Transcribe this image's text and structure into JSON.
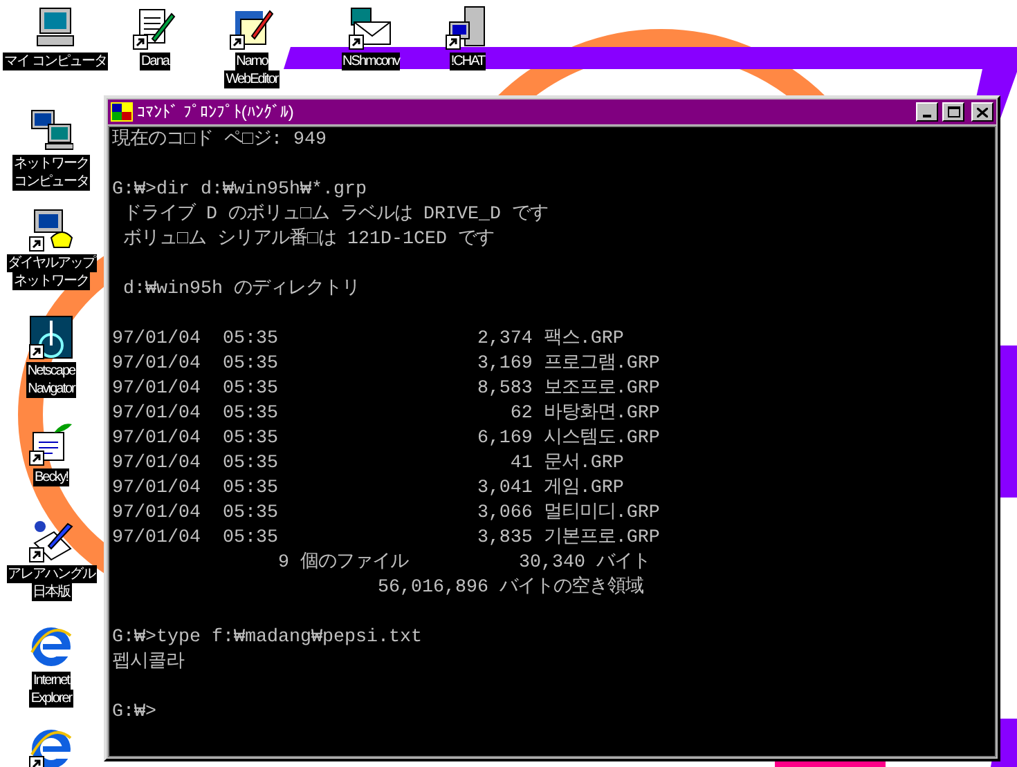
{
  "desktop": {
    "top_row": [
      {
        "label_lines": [
          "マイ コンピュータ"
        ],
        "shortcut": false
      },
      {
        "label_lines": [
          "Dana"
        ],
        "shortcut": true
      },
      {
        "label_lines": [
          "Namo",
          "WebEditor"
        ],
        "shortcut": true
      },
      {
        "label_lines": [
          "NShmconv"
        ],
        "shortcut": true
      },
      {
        "label_lines": [
          "!CHAT"
        ],
        "shortcut": true
      }
    ],
    "left_column": [
      {
        "label_lines": [
          "ネットワーク",
          "コンピュータ"
        ],
        "shortcut": false
      },
      {
        "label_lines": [
          "ダイヤルアップ",
          "ネットワーク"
        ],
        "shortcut": true
      },
      {
        "label_lines": [
          "Netscape",
          "Navigator"
        ],
        "shortcut": true
      },
      {
        "label_lines": [
          "Becky!"
        ],
        "shortcut": true
      },
      {
        "label_lines": [
          "アレアハングル",
          "日本版"
        ],
        "shortcut": true
      },
      {
        "label_lines": [
          "Internet",
          "Explorer"
        ],
        "shortcut": false
      },
      {
        "shortcut": true
      }
    ]
  },
  "window": {
    "title": "ｺﾏﾝﾄﾞ ﾌﾟﾛﾝﾌﾟﾄ(ﾊﾝｸﾞﾙ)",
    "console": {
      "blocks": [
        [
          "現在のコ□ド ペ□ジ: 949"
        ],
        [
          "G:₩>dir d:₩win95h₩*.grp",
          " ドライブ D のボリュ□ム ラベルは DRIVE_D です",
          " ボリュ□ム シリアル番□は 121D-1CED です"
        ],
        [
          " d:₩win95h のディレクトリ"
        ],
        [
          "97/01/04  05:35                  2,374 팩스.GRP",
          "97/01/04  05:35                  3,169 프로그램.GRP",
          "97/01/04  05:35                  8,583 보조프로.GRP",
          "97/01/04  05:35                     62 바탕화면.GRP",
          "97/01/04  05:35                  6,169 시스템도.GRP",
          "97/01/04  05:35                     41 문서.GRP",
          "97/01/04  05:35                  3,041 게임.GRP",
          "97/01/04  05:35                  3,066 멀티미디.GRP",
          "97/01/04  05:35                  3,835 기본프로.GRP",
          "               9 個のファイル          30,340 バイト",
          "                        56,016,896 バイトの空き領域"
        ],
        [
          "G:₩>type f:₩madang₩pepsi.txt",
          "펩시콜라"
        ],
        [
          "G:₩>"
        ]
      ]
    }
  }
}
